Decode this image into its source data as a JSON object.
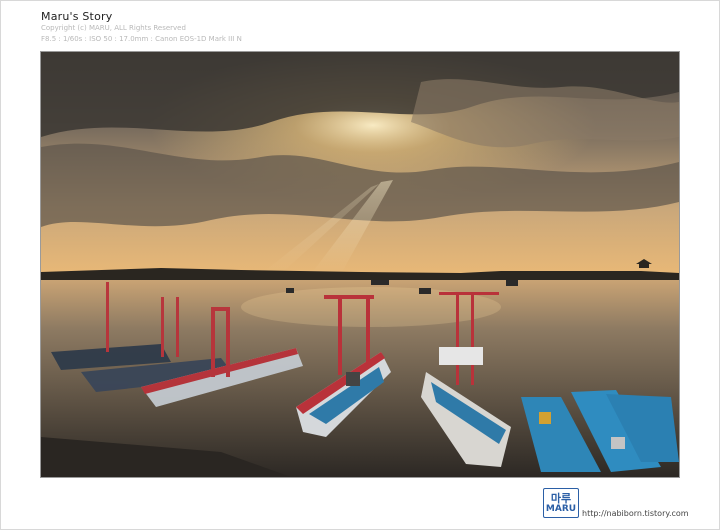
{
  "header": {
    "title": "Maru's Story",
    "copyright": "Copyright (c) MARU, ALL Rights Reserved",
    "exif": "F8.5 : 1/60s : ISO 50 : 17.0mm : Canon EOS-1D Mark III N"
  },
  "photo": {
    "alt": "Harbor at sunset with moored fishing boats under a cloudy sky"
  },
  "signature": {
    "logo_top": "마루",
    "logo_bottom": "MARU",
    "url": "http://nabiborn.tistory.com"
  },
  "colors": {
    "logo_blue": "#2b5fa6",
    "sky_glow": "#f3c97a",
    "water": "#4a4238"
  }
}
